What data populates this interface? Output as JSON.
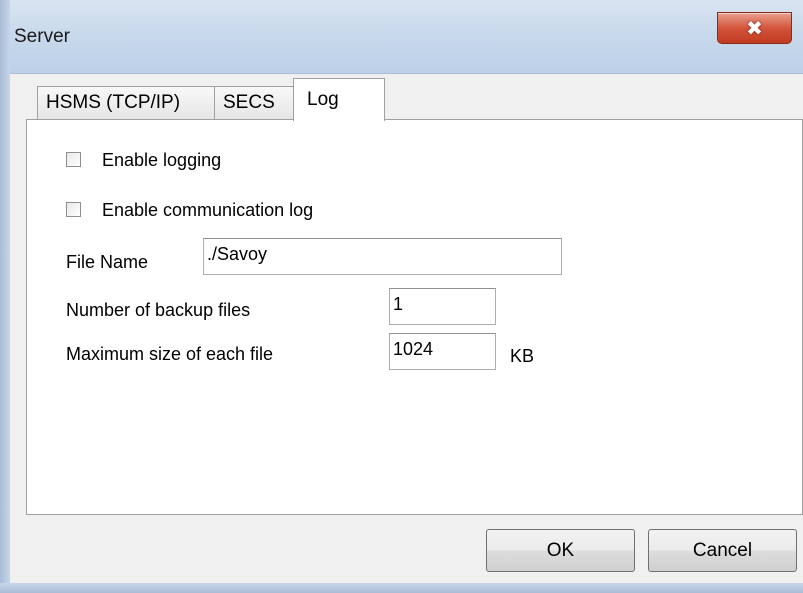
{
  "window": {
    "title": "Server",
    "close_glyph": "✖"
  },
  "tabs": [
    {
      "label": "HSMS (TCP/IP)",
      "active": false
    },
    {
      "label": "SECS",
      "active": false
    },
    {
      "label": "Log",
      "active": true
    }
  ],
  "log": {
    "enable_logging": {
      "label": "Enable logging",
      "checked": false
    },
    "enable_comm_log": {
      "label": "Enable communication log",
      "checked": false
    },
    "file_name": {
      "label": "File Name",
      "value": "./Savoy"
    },
    "backup_files": {
      "label": "Number of backup files",
      "value": "1"
    },
    "max_size": {
      "label": "Maximum size of each file",
      "value": "1024",
      "unit": "KB"
    }
  },
  "buttons": {
    "ok": "OK",
    "cancel": "Cancel"
  },
  "colors": {
    "titlebar": "#c9d9ec",
    "close_button": "#d3553c",
    "panel": "#ffffff",
    "window_bg": "#f0f0f0"
  }
}
